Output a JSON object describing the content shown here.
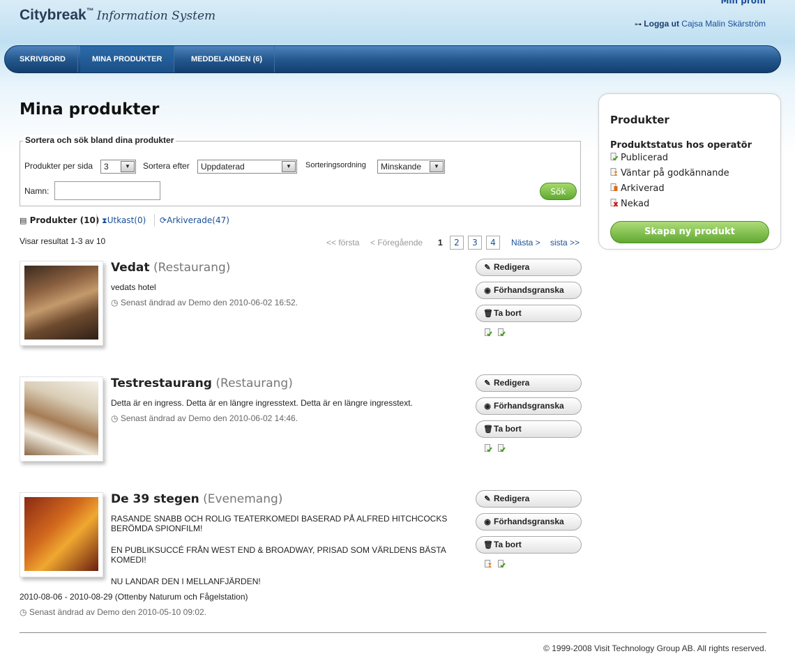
{
  "header": {
    "logo_main": "Citybreak",
    "logo_tm": "™",
    "logo_sub": "Information System",
    "my_profile": "Min profil",
    "logout_label": "Logga ut",
    "user_name": "Cajsa Malin Skärström"
  },
  "nav": {
    "items": [
      {
        "label": "SKRIVBORD"
      },
      {
        "label": "MINA PRODUKTER"
      },
      {
        "label": "MEDDELANDEN (6)"
      }
    ]
  },
  "main": {
    "title": "Mina produkter",
    "sort": {
      "legend": "Sortera och sök bland dina produkter",
      "per_page_label": "Produkter per sida",
      "per_page_value": "3",
      "sort_by_label": "Sortera efter",
      "sort_by_value": "Uppdaterad",
      "order_label": "Sorteringsordning",
      "order_value": "Minskande",
      "name_label": "Namn:",
      "name_value": "",
      "search_button": "Sök"
    },
    "tabs": [
      {
        "label": "Produkter (10)"
      },
      {
        "label": "Utkast(0)"
      },
      {
        "label": "Arkiverade(47)"
      }
    ],
    "results_text": "Visar resultat 1-3 av 10",
    "pager": {
      "first": "<< första",
      "prev": "< Föregående",
      "current": "1",
      "pages": [
        "2",
        "3",
        "4"
      ],
      "next": "Nästa >",
      "last": "sista >>"
    },
    "products": [
      {
        "name": "Vedat",
        "category": "(Restaurang)",
        "desc": [
          "vedats hotel"
        ],
        "modified": "Senast ändrad av  Demo den 2010-06-02 16:52.",
        "statuses": [
          "published",
          "published"
        ]
      },
      {
        "name": "Testrestaurang",
        "category": "(Restaurang)",
        "desc": [
          "Detta är en ingress. Detta är en längre ingresstext. Detta är en längre ingresstext."
        ],
        "modified": "Senast ändrad av  Demo den 2010-06-02 14:46.",
        "statuses": [
          "published",
          "published"
        ]
      },
      {
        "name": "De 39 stegen",
        "category": "(Evenemang)",
        "desc": [
          "RASANDE SNABB OCH ROLIG TEATERKOMEDI BASERAD PÅ ALFRED HITCHCOCKS BERÖMDA SPIONFILM!",
          "EN PUBLIKSUCCÉ FRÅN WEST END & BROADWAY, PRISAD SOM VÄRLDENS BÄSTA KOMEDI!",
          "NU LANDAR DEN I MELLANFJÄRDEN!"
        ],
        "dates": "2010-08-06 - 2010-08-29 (Ottenby Naturum och Fågelstation)",
        "modified": "Senast ändrad av  Demo den 2010-05-10 09:02.",
        "statuses": [
          "pending",
          "published"
        ]
      }
    ],
    "buttons": {
      "edit": "Redigera",
      "preview": "Förhandsgranska",
      "delete": "Ta bort"
    }
  },
  "sidebar": {
    "title": "Produkter",
    "status_title": "Produktstatus hos operatör",
    "legend": [
      {
        "label": "Publicerad",
        "icon": "published-icon"
      },
      {
        "label": "Väntar på godkännande",
        "icon": "pending-icon"
      },
      {
        "label": "Arkiverad",
        "icon": "archived-icon"
      },
      {
        "label": "Nekad",
        "icon": "denied-icon"
      }
    ],
    "new_product": "Skapa ny produkt"
  },
  "footer": "© 1999-2008 Visit Technology Group AB. All rights reserved.",
  "colors": {
    "nav": "#24598f",
    "accent_green": "#60a932",
    "link": "#1a4f98"
  }
}
